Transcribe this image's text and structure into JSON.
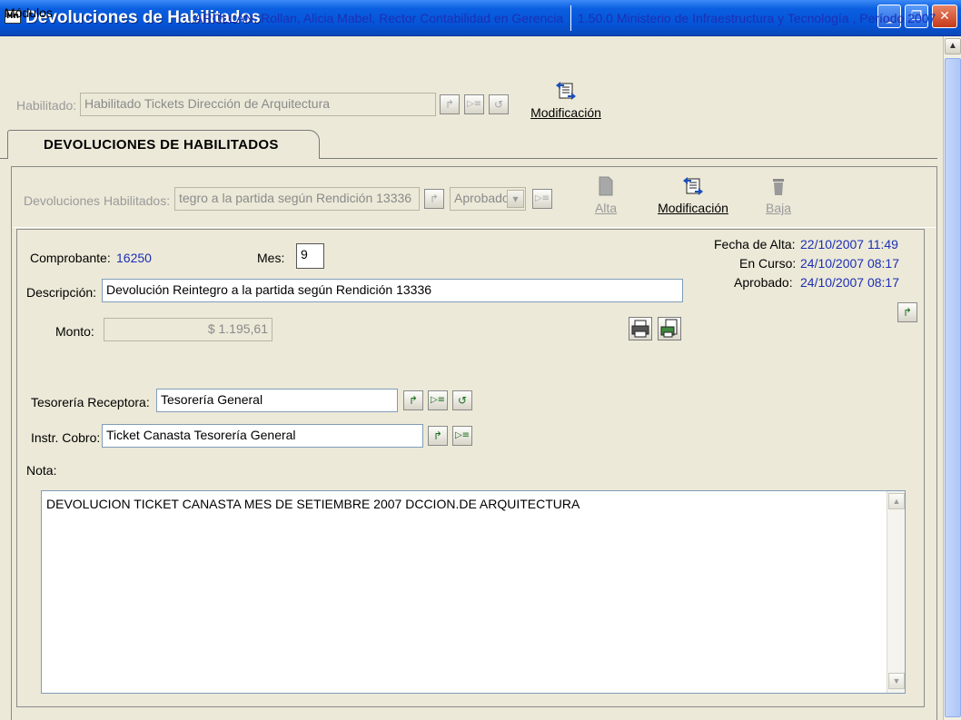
{
  "window": {
    "title": "Devoluciones de Habilitados",
    "app_icon_text": "Hn",
    "minimize": "_",
    "maximize": "❐",
    "close": "✕"
  },
  "menubar": {
    "modulos": "Módulos",
    "user_info": "AROLLAN, Rollan, Alicia Mabel, Rector Contabilidad en Gerencia",
    "system_info": "1.50.0 Ministerio de Infraestructura y Tecnología , Período 2007"
  },
  "habilitado": {
    "label": "Habilitado:",
    "value": "Habilitado  Tickets Dirección de Arquitectura",
    "modificacion_label": "Modificación"
  },
  "tab": {
    "label": "DEVOLUCIONES DE HABILITADOS"
  },
  "devoluciones": {
    "label": "Devoluciones Habilitados:",
    "value": "tegro a la partida según Rendición 13336",
    "estado_value": "Aprobado",
    "alta_label": "Alta",
    "modificacion_label": "Modificación",
    "baja_label": "Baja"
  },
  "detalle": {
    "comprobante_label": "Comprobante:",
    "comprobante_value": "16250",
    "mes_label": "Mes:",
    "mes_value": "9",
    "descripcion_label": "Descripción:",
    "descripcion_value": "Devolución Reintegro a la partida según Rendición 13336",
    "monto_label": "Monto:",
    "monto_value": "$ 1.195,61",
    "fecha_alta_label": "Fecha de Alta:",
    "fecha_alta_value": "22/10/2007 11:49",
    "en_curso_label": "En Curso:",
    "en_curso_value": "24/10/2007 08:17",
    "aprobado_label": "Aprobado:",
    "aprobado_value": "24/10/2007 08:17",
    "tesoreria_label": "Tesorería Receptora:",
    "tesoreria_value": "Tesorería General",
    "instr_cobro_label": "Instr. Cobro:",
    "instr_cobro_value": "Ticket Canasta Tesorería General",
    "nota_label": "Nota:",
    "nota_value": "DEVOLUCION TICKET CANASTA MES DE SETIEMBRE 2007 DCCION.DE ARQUITECTURA"
  },
  "icons": {
    "goto": "↱",
    "list": "▷≡",
    "undo": "↺",
    "dropdown": "▾",
    "scroll_up": "▲",
    "scroll_down": "▼"
  },
  "colors": {
    "titlebar": "#0553d6",
    "info_text": "#1c2fb5",
    "window_bg": "#ece9d8"
  }
}
